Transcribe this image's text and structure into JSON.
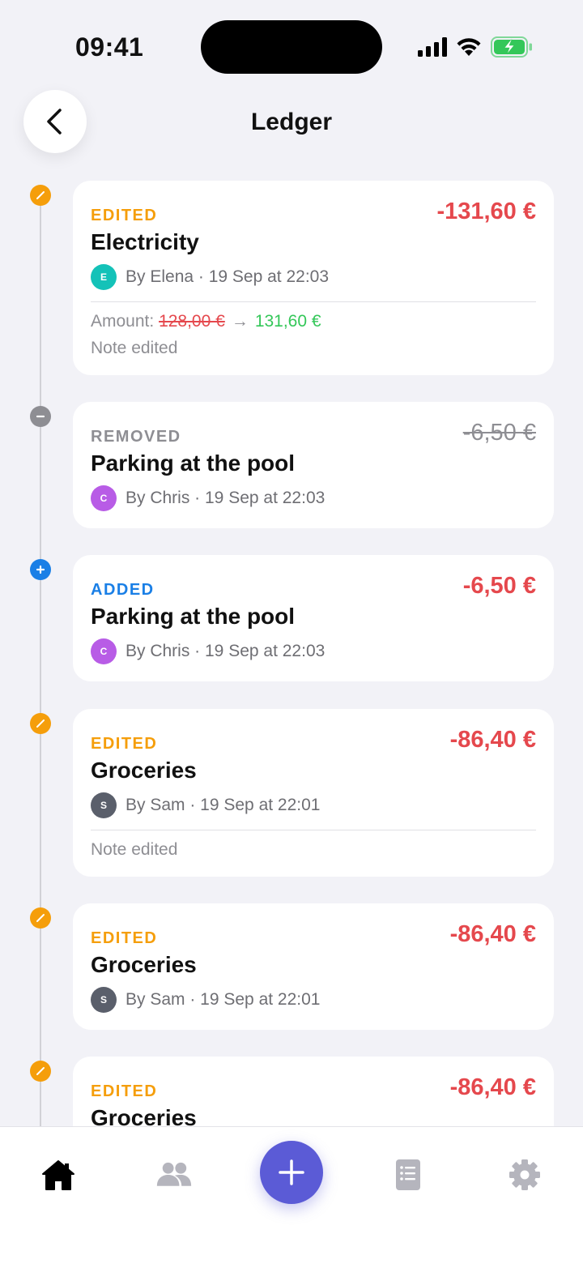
{
  "status_bar": {
    "time": "09:41"
  },
  "header": {
    "title": "Ledger"
  },
  "entries": [
    {
      "tag": "EDITED",
      "name": "Electricity",
      "amount": "-131,60 €",
      "avatar_letter": "E",
      "meta": "By Elena · 19 Sep at 22:03",
      "amount_label": "Amount:",
      "old_amount": "128,00 €",
      "new_amount": "131,60 €",
      "arrow": "→",
      "note": "Note edited"
    },
    {
      "tag": "REMOVED",
      "name": "Parking at the pool",
      "amount": "-6,50 €",
      "avatar_letter": "C",
      "meta": "By Chris · 19 Sep at 22:03"
    },
    {
      "tag": "ADDED",
      "name": "Parking at the pool",
      "amount": "-6,50 €",
      "avatar_letter": "C",
      "meta": "By Chris · 19 Sep at 22:03"
    },
    {
      "tag": "EDITED",
      "name": "Groceries",
      "amount": "-86,40 €",
      "avatar_letter": "S",
      "meta": "By Sam · 19 Sep at 22:01",
      "note": "Note edited"
    },
    {
      "tag": "EDITED",
      "name": "Groceries",
      "amount": "-86,40 €",
      "avatar_letter": "S",
      "meta": "By Sam · 19 Sep at 22:01"
    },
    {
      "tag": "EDITED",
      "name": "Groceries",
      "amount": "-86,40 €"
    }
  ],
  "colors": {
    "edited": "#f59e0b",
    "removed": "#8e8e93",
    "added": "#1a7fe6",
    "negative": "#e5484d",
    "positive": "#34c759",
    "accent": "#5b5bd6",
    "avatar_elena": "#14c2b8",
    "avatar_chris": "#b85ce6",
    "avatar_sam": "#5a5f6b"
  },
  "tab_bar": {
    "items": [
      "home-icon",
      "people-icon",
      "add-icon",
      "list-icon",
      "gear-icon"
    ]
  }
}
